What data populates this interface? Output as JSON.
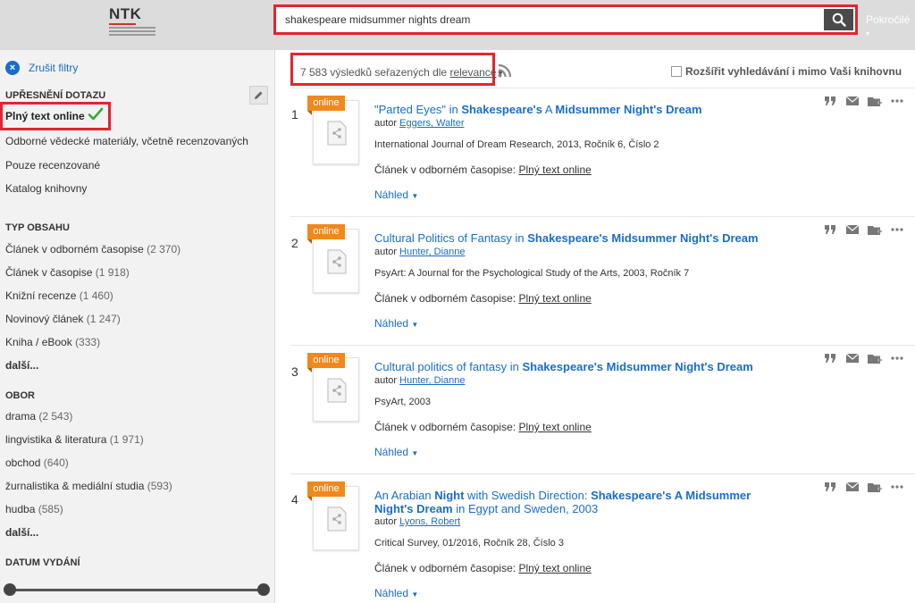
{
  "header": {
    "logo_text": "NTK",
    "search_value": "shakespeare midsummer nights dream",
    "advanced_label": "Pokročilé"
  },
  "sidebar": {
    "cancel_filters": "Zrušit filtry",
    "refine_heading": "UPŘESNĚNÍ DOTAZU",
    "refine_items": [
      {
        "label": "Plný text online",
        "active": true
      },
      {
        "label": "Odborné vědecké materiály, včetně recenzovaných"
      },
      {
        "label": "Pouze recenzované"
      },
      {
        "label": "Katalog knihovny"
      }
    ],
    "content_type_heading": "TYP OBSAHU",
    "content_types": [
      {
        "label": "Článek v odborném časopise",
        "count": "(2 370)"
      },
      {
        "label": "Článek v časopise",
        "count": "(1 918)"
      },
      {
        "label": "Knižní recenze",
        "count": "(1 460)"
      },
      {
        "label": "Novinový článek",
        "count": "(1 247)"
      },
      {
        "label": "Kniha / eBook",
        "count": "(333)"
      }
    ],
    "content_more": "další...",
    "field_heading": "OBOR",
    "fields": [
      {
        "label": "drama",
        "count": "(2 543)"
      },
      {
        "label": "lingvistika & literatura",
        "count": "(1 971)"
      },
      {
        "label": "obchod",
        "count": "(640)"
      },
      {
        "label": "žurnalistika & mediální studia",
        "count": "(593)"
      },
      {
        "label": "hudba",
        "count": "(585)"
      }
    ],
    "field_more": "další...",
    "date_heading": "DATUM VYDÁNÍ"
  },
  "main": {
    "results_count": "7 583 výsledků seřazených dle",
    "sort_value": "relevance",
    "expand_label": "Rozšířit vyhledávání i mimo Vaši knihovnu",
    "online_tag": "online",
    "author_prefix": "autor",
    "avail_prefix": "Článek v odborném časopise:",
    "avail_link": "Plný text online",
    "preview_label": "Náhled",
    "results": [
      {
        "num": "1",
        "title_a": "\"Parted Eyes\" in ",
        "title_b": "Shakespeare's",
        "title_c": " A ",
        "title_d": "Midsummer Night's Dream",
        "title_e": "",
        "author": "Eggers, Walter",
        "source": "International Journal of Dream Research, 2013, Ročník 6, Číslo 2"
      },
      {
        "num": "2",
        "title_a": "Cultural Politics of Fantasy in ",
        "title_b": "Shakespeare's Midsummer Night's Dream",
        "title_c": "",
        "title_d": "",
        "title_e": "",
        "author": "Hunter, Dianne",
        "source": "PsyArt: A Journal for the Psychological Study of the Arts, 2003, Ročník 7"
      },
      {
        "num": "3",
        "title_a": "Cultural politics of fantasy in ",
        "title_b": "Shakespeare's Midsummer Night's Dream",
        "title_c": "",
        "title_d": "",
        "title_e": "",
        "author": "Hunter, Dianne",
        "source": "PsyArt, 2003"
      },
      {
        "num": "4",
        "title_a": "An Arabian ",
        "title_b": "Night",
        "title_c": " with Swedish Direction: ",
        "title_d": "Shakespeare's A Midsummer Night's Dream",
        "title_e": " in Egypt and Sweden, 2003",
        "author": "Lyons, Robert",
        "source": "Critical Survey, 01/2016, Ročník 28, Číslo 3"
      }
    ]
  },
  "colors": {
    "accent": "#1a6ec5",
    "highlight_border": "#e0262f",
    "online_tag": "#f0891c"
  }
}
